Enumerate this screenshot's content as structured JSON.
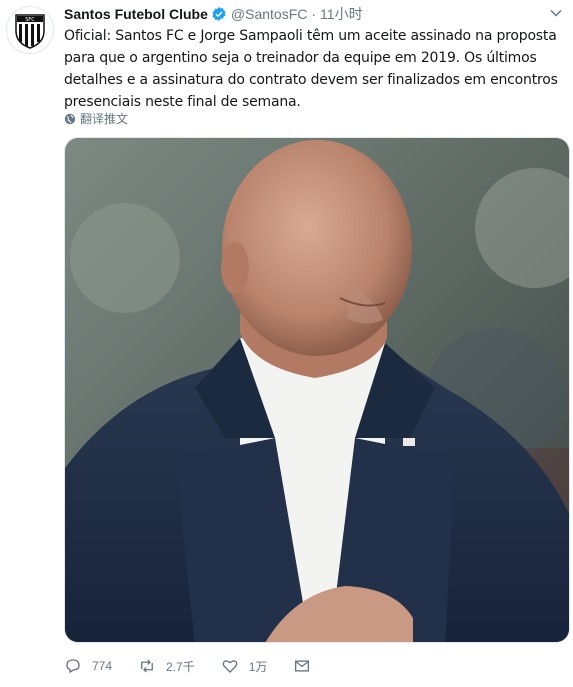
{
  "tweet": {
    "author": {
      "name": "Santos Futebol Clube",
      "handle": "@SantosFC",
      "avatar_icon": "santos-crest-icon",
      "verified_icon": "verified-badge-icon"
    },
    "separator": "·",
    "time": "11小时",
    "text": "Oficial: Santos FC e Jorge Sampaoli têm um aceite assinado na proposta para que o argentino seja o treinador da equipe em 2019. Os últimos detalhes e a assinatura do contrato devem ser finalizados em encontros presenciais neste final de semana.",
    "translate_label": "翻译推文",
    "actions": {
      "reply_count": "774",
      "retweet_count": "2.7千",
      "like_count": "1万"
    }
  },
  "colors": {
    "text": "#14171a",
    "secondary": "#657786",
    "verified": "#1da1f2",
    "border": "#e1e8ed"
  }
}
